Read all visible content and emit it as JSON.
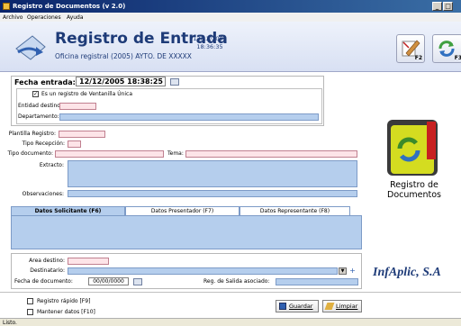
{
  "window": {
    "title": "Registro de Documentos (v 2.0)"
  },
  "menu": {
    "items": [
      "Archivo",
      "Operaciones",
      "Ayuda"
    ]
  },
  "header": {
    "title": "Registro de Entrada",
    "date": "12/12/2005",
    "time": "18:36:35",
    "subtitle": "Oficina registral (2005) AYTO. DE XXXXX",
    "btn_f2": "F2",
    "btn_f3": "F3"
  },
  "entry": {
    "fecha_label": "Fecha entrada:",
    "fecha_value": "12/12/2005 18:38:25",
    "ventanilla_label": "Es un registro de Ventanilla Única",
    "ventanilla_checked": "✓",
    "entidad_label": "Entidad destino:",
    "departamento_label": "Departamento:"
  },
  "form": {
    "plantilla_label": "Plantilla Registro:",
    "tipo_recepcion_label": "Tipo Recepción:",
    "tipo_documento_label": "Tipo documento:",
    "tema_label": "Tema:",
    "extracto_label": "Extracto:",
    "observaciones_label": "Observaciones:"
  },
  "tabs": [
    "Datos Solicitante (F6)",
    "Datos Presentador (F7)",
    "Datos Representante (F8)"
  ],
  "dest": {
    "area_label": "Area destino:",
    "destinatario_label": "Destinatario:",
    "fecha_doc_label": "Fecha de documento:",
    "fecha_doc_value": "00/00/0000",
    "salida_label": "Reg. de Salida asociado:"
  },
  "side": {
    "caption_line1": "Registro de",
    "caption_line2": "Documentos",
    "brand": "InfAplic, S.A"
  },
  "footer": {
    "rapido_label": "Registro rápido [F9]",
    "mantener_label": "Mantener datos [F10]",
    "guardar_label": "Guardar",
    "limpiar_label": "Limpiar"
  },
  "status": {
    "text": "Listo."
  },
  "colors": {
    "accent": "#1e3b78",
    "field_blue": "#b5ceed",
    "field_pink": "#fde4e8"
  }
}
